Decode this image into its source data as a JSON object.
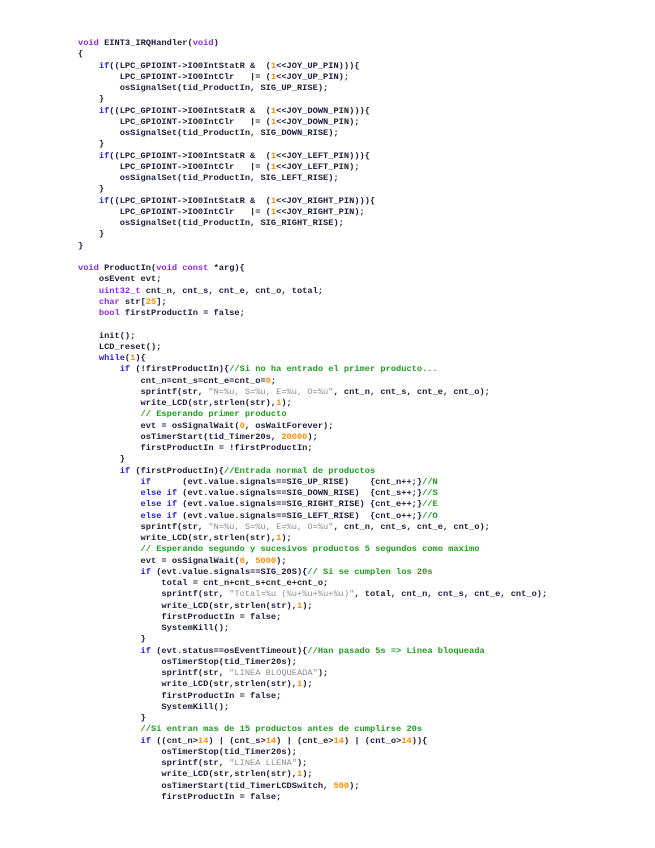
{
  "code_lines": [
    [
      [
        "k",
        "void"
      ],
      [
        "p",
        " EINT3_IRQHandler("
      ],
      [
        "k",
        "void"
      ],
      [
        "p",
        ")"
      ]
    ],
    [
      [
        "p",
        "{"
      ]
    ],
    [
      [
        "c",
        "    if"
      ],
      [
        "p",
        "((LPC_GPIOINT->IO0IntStatR &  ("
      ],
      [
        "n",
        "1"
      ],
      [
        "p",
        "<<JOY_UP_PIN))){"
      ]
    ],
    [
      [
        "p",
        "        LPC_GPIOINT->IO0IntClr   |= ("
      ],
      [
        "n",
        "1"
      ],
      [
        "p",
        "<<JOY_UP_PIN);"
      ]
    ],
    [
      [
        "p",
        "        osSignalSet(tid_ProductIn, SIG_UP_RISE);"
      ]
    ],
    [
      [
        "p",
        "    }"
      ]
    ],
    [
      [
        "c",
        "    if"
      ],
      [
        "p",
        "((LPC_GPIOINT->IO0IntStatR &  ("
      ],
      [
        "n",
        "1"
      ],
      [
        "p",
        "<<JOY_DOWN_PIN))){"
      ]
    ],
    [
      [
        "p",
        "        LPC_GPIOINT->IO0IntClr   |= ("
      ],
      [
        "n",
        "1"
      ],
      [
        "p",
        "<<JOY_DOWN_PIN);"
      ]
    ],
    [
      [
        "p",
        "        osSignalSet(tid_ProductIn, SIG_DOWN_RISE);"
      ]
    ],
    [
      [
        "p",
        "    }"
      ]
    ],
    [
      [
        "c",
        "    if"
      ],
      [
        "p",
        "((LPC_GPIOINT->IO0IntStatR &  ("
      ],
      [
        "n",
        "1"
      ],
      [
        "p",
        "<<JOY_LEFT_PIN))){"
      ]
    ],
    [
      [
        "p",
        "        LPC_GPIOINT->IO0IntClr   |= ("
      ],
      [
        "n",
        "1"
      ],
      [
        "p",
        "<<JOY_LEFT_PIN);"
      ]
    ],
    [
      [
        "p",
        "        osSignalSet(tid_ProductIn, SIG_LEFT_RISE);"
      ]
    ],
    [
      [
        "p",
        "    }"
      ]
    ],
    [
      [
        "c",
        "    if"
      ],
      [
        "p",
        "((LPC_GPIOINT->IO0IntStatR &  ("
      ],
      [
        "n",
        "1"
      ],
      [
        "p",
        "<<JOY_RIGHT_PIN))){"
      ]
    ],
    [
      [
        "p",
        "        LPC_GPIOINT->IO0IntClr   |= ("
      ],
      [
        "n",
        "1"
      ],
      [
        "p",
        "<<JOY_RIGHT_PIN);"
      ]
    ],
    [
      [
        "p",
        "        osSignalSet(tid_ProductIn, SIG_RIGHT_RISE);"
      ]
    ],
    [
      [
        "p",
        "    }"
      ]
    ],
    [
      [
        "p",
        "}"
      ]
    ],
    [],
    [
      [
        "k",
        "void"
      ],
      [
        "p",
        " ProductIn("
      ],
      [
        "k",
        "void const"
      ],
      [
        "p",
        " *arg){"
      ]
    ],
    [
      [
        "p",
        "    osEvent evt;"
      ]
    ],
    [
      [
        "k",
        "    uint32_t"
      ],
      [
        "p",
        " cnt_n, cnt_s, cnt_e, cnt_o, total;"
      ]
    ],
    [
      [
        "k",
        "    char"
      ],
      [
        "p",
        " str["
      ],
      [
        "n",
        "25"
      ],
      [
        "p",
        "];"
      ]
    ],
    [
      [
        "k",
        "    bool"
      ],
      [
        "p",
        " firstProductIn = false;"
      ]
    ],
    [],
    [
      [
        "p",
        "    init();"
      ]
    ],
    [
      [
        "p",
        "    LCD_reset();"
      ]
    ],
    [
      [
        "c",
        "    while"
      ],
      [
        "p",
        "("
      ],
      [
        "n",
        "1"
      ],
      [
        "p",
        "){"
      ]
    ],
    [
      [
        "c",
        "        if"
      ],
      [
        "p",
        " (!firstProductIn){"
      ],
      [
        "m",
        "//Si no ha entrado el primer producto..."
      ]
    ],
    [
      [
        "p",
        "            cnt_n=cnt_s=cnt_e=cnt_o="
      ],
      [
        "n",
        "0"
      ],
      [
        "p",
        ";"
      ]
    ],
    [
      [
        "p",
        "            sprintf(str, "
      ],
      [
        "s",
        "\"N=%u, S=%u, E=%u, O=%u\""
      ],
      [
        "p",
        ", cnt_n, cnt_s, cnt_e, cnt_o);"
      ]
    ],
    [
      [
        "p",
        "            write_LCD(str,strlen(str),"
      ],
      [
        "n",
        "1"
      ],
      [
        "p",
        ");"
      ]
    ],
    [
      [
        "m",
        "            // Esperando primer producto"
      ]
    ],
    [
      [
        "p",
        "            evt = osSignalWait("
      ],
      [
        "n",
        "0"
      ],
      [
        "p",
        ", osWaitForever);"
      ]
    ],
    [
      [
        "p",
        "            osTimerStart(tid_Timer20s, "
      ],
      [
        "n",
        "20000"
      ],
      [
        "p",
        ");"
      ]
    ],
    [
      [
        "p",
        "            firstProductIn = !firstProductIn;"
      ]
    ],
    [
      [
        "p",
        "        }"
      ]
    ],
    [
      [
        "c",
        "        if"
      ],
      [
        "p",
        " (firstProductIn){"
      ],
      [
        "m",
        "//Entrada normal de productos"
      ]
    ],
    [
      [
        "c",
        "            if"
      ],
      [
        "p",
        "      (evt.value.signals==SIG_UP_RISE)    {cnt_n++;}"
      ],
      [
        "m",
        "//N"
      ]
    ],
    [
      [
        "c",
        "            else if"
      ],
      [
        "p",
        " (evt.value.signals==SIG_DOWN_RISE)  {cnt_s++;}"
      ],
      [
        "m",
        "//S"
      ]
    ],
    [
      [
        "c",
        "            else if"
      ],
      [
        "p",
        " (evt.value.signals==SIG_RIGHT_RISE) {cnt_e++;}"
      ],
      [
        "m",
        "//E"
      ]
    ],
    [
      [
        "c",
        "            else if"
      ],
      [
        "p",
        " (evt.value.signals==SIG_LEFT_RISE)  {cnt_o++;}"
      ],
      [
        "m",
        "//O"
      ]
    ],
    [
      [
        "p",
        "            sprintf(str, "
      ],
      [
        "s",
        "\"N=%u, S=%u, E=%u, O=%u\""
      ],
      [
        "p",
        ", cnt_n, cnt_s, cnt_e, cnt_o);"
      ]
    ],
    [
      [
        "p",
        "            write_LCD(str,strlen(str),"
      ],
      [
        "n",
        "1"
      ],
      [
        "p",
        ");"
      ]
    ],
    [
      [
        "m",
        "            // Esperando segundo y sucesivos productos 5 segundos como maximo"
      ]
    ],
    [
      [
        "p",
        "            evt = osSignalWait("
      ],
      [
        "n",
        "0"
      ],
      [
        "p",
        ", "
      ],
      [
        "n",
        "5000"
      ],
      [
        "p",
        ");"
      ]
    ],
    [
      [
        "c",
        "            if"
      ],
      [
        "p",
        " (evt.value.signals==SIG_20S){"
      ],
      [
        "m",
        "// Si se cumplen los 20s"
      ]
    ],
    [
      [
        "p",
        "                total = cnt_n+cnt_s+cnt_e+cnt_o;"
      ]
    ],
    [
      [
        "p",
        "                sprintf(str, "
      ],
      [
        "s",
        "\"Total=%u (%u+%u+%u+%u)\""
      ],
      [
        "p",
        ", total, cnt_n, cnt_s, cnt_e, cnt_o);"
      ]
    ],
    [
      [
        "p",
        "                write_LCD(str,strlen(str),"
      ],
      [
        "n",
        "1"
      ],
      [
        "p",
        ");"
      ]
    ],
    [
      [
        "p",
        "                firstProductIn = false;"
      ]
    ],
    [
      [
        "p",
        "                SystemKill();"
      ]
    ],
    [
      [
        "p",
        "            }"
      ]
    ],
    [
      [
        "c",
        "            if"
      ],
      [
        "p",
        " (evt.status==osEventTimeout){"
      ],
      [
        "m",
        "//Han pasado 5s => Linea bloqueada"
      ]
    ],
    [
      [
        "p",
        "                osTimerStop(tid_Timer20s);"
      ]
    ],
    [
      [
        "p",
        "                sprintf(str, "
      ],
      [
        "s",
        "\"LINEA BLOQUEADA\""
      ],
      [
        "p",
        ");"
      ]
    ],
    [
      [
        "p",
        "                write_LCD(str,strlen(str),"
      ],
      [
        "n",
        "1"
      ],
      [
        "p",
        ");"
      ]
    ],
    [
      [
        "p",
        "                firstProductIn = false;"
      ]
    ],
    [
      [
        "p",
        "                SystemKill();"
      ]
    ],
    [
      [
        "p",
        "            }"
      ]
    ],
    [
      [
        "m",
        "            //Si entran mas de 15 productos antes de cumplirse 20s"
      ]
    ],
    [
      [
        "c",
        "            if"
      ],
      [
        "p",
        " ((cnt_n>"
      ],
      [
        "n",
        "14"
      ],
      [
        "p",
        ") | (cnt_s>"
      ],
      [
        "n",
        "14"
      ],
      [
        "p",
        ") | (cnt_e>"
      ],
      [
        "n",
        "14"
      ],
      [
        "p",
        ") | (cnt_o>"
      ],
      [
        "n",
        "14"
      ],
      [
        "p",
        ")){"
      ]
    ],
    [
      [
        "p",
        "                osTimerStop(tid_Timer20s);"
      ]
    ],
    [
      [
        "p",
        "                sprintf(str, "
      ],
      [
        "s",
        "\"LINEA LLENA\""
      ],
      [
        "p",
        ");"
      ]
    ],
    [
      [
        "p",
        "                write_LCD(str,strlen(str),"
      ],
      [
        "n",
        "1"
      ],
      [
        "p",
        ");"
      ]
    ],
    [
      [
        "p",
        "                osTimerStart(tid_TimerLCDSwitch, "
      ],
      [
        "n",
        "500"
      ],
      [
        "p",
        ");"
      ]
    ],
    [
      [
        "p",
        "                firstProductIn = false;"
      ]
    ]
  ]
}
